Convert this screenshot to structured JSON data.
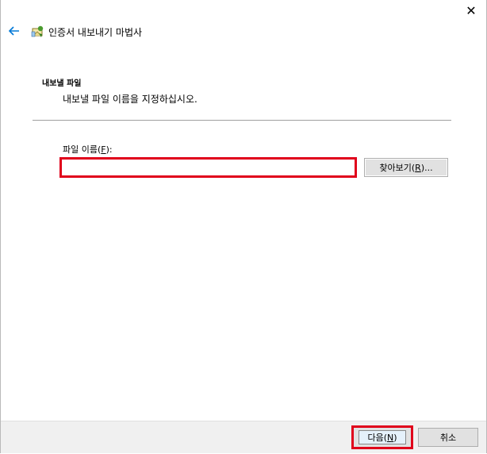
{
  "window": {
    "close_glyph": "✕"
  },
  "wizard": {
    "title": "인증서 내보내기 마법사"
  },
  "section": {
    "title": "내보낼 파일",
    "description": "내보낼 파일 이름을 지정하십시오."
  },
  "file_name": {
    "label_pre": "파일 이름(",
    "label_mnemonic": "F",
    "label_post": "):",
    "value": "",
    "highlight_color": "#e0001b"
  },
  "browse": {
    "label_pre": "찾아보기(",
    "label_mnemonic": "R",
    "label_post": ")..."
  },
  "footer": {
    "next_pre": "다음(",
    "next_mnemonic": "N",
    "next_post": ")",
    "cancel": "취소"
  },
  "colors": {
    "accent": "#0078d7",
    "highlight": "#e0001b"
  }
}
